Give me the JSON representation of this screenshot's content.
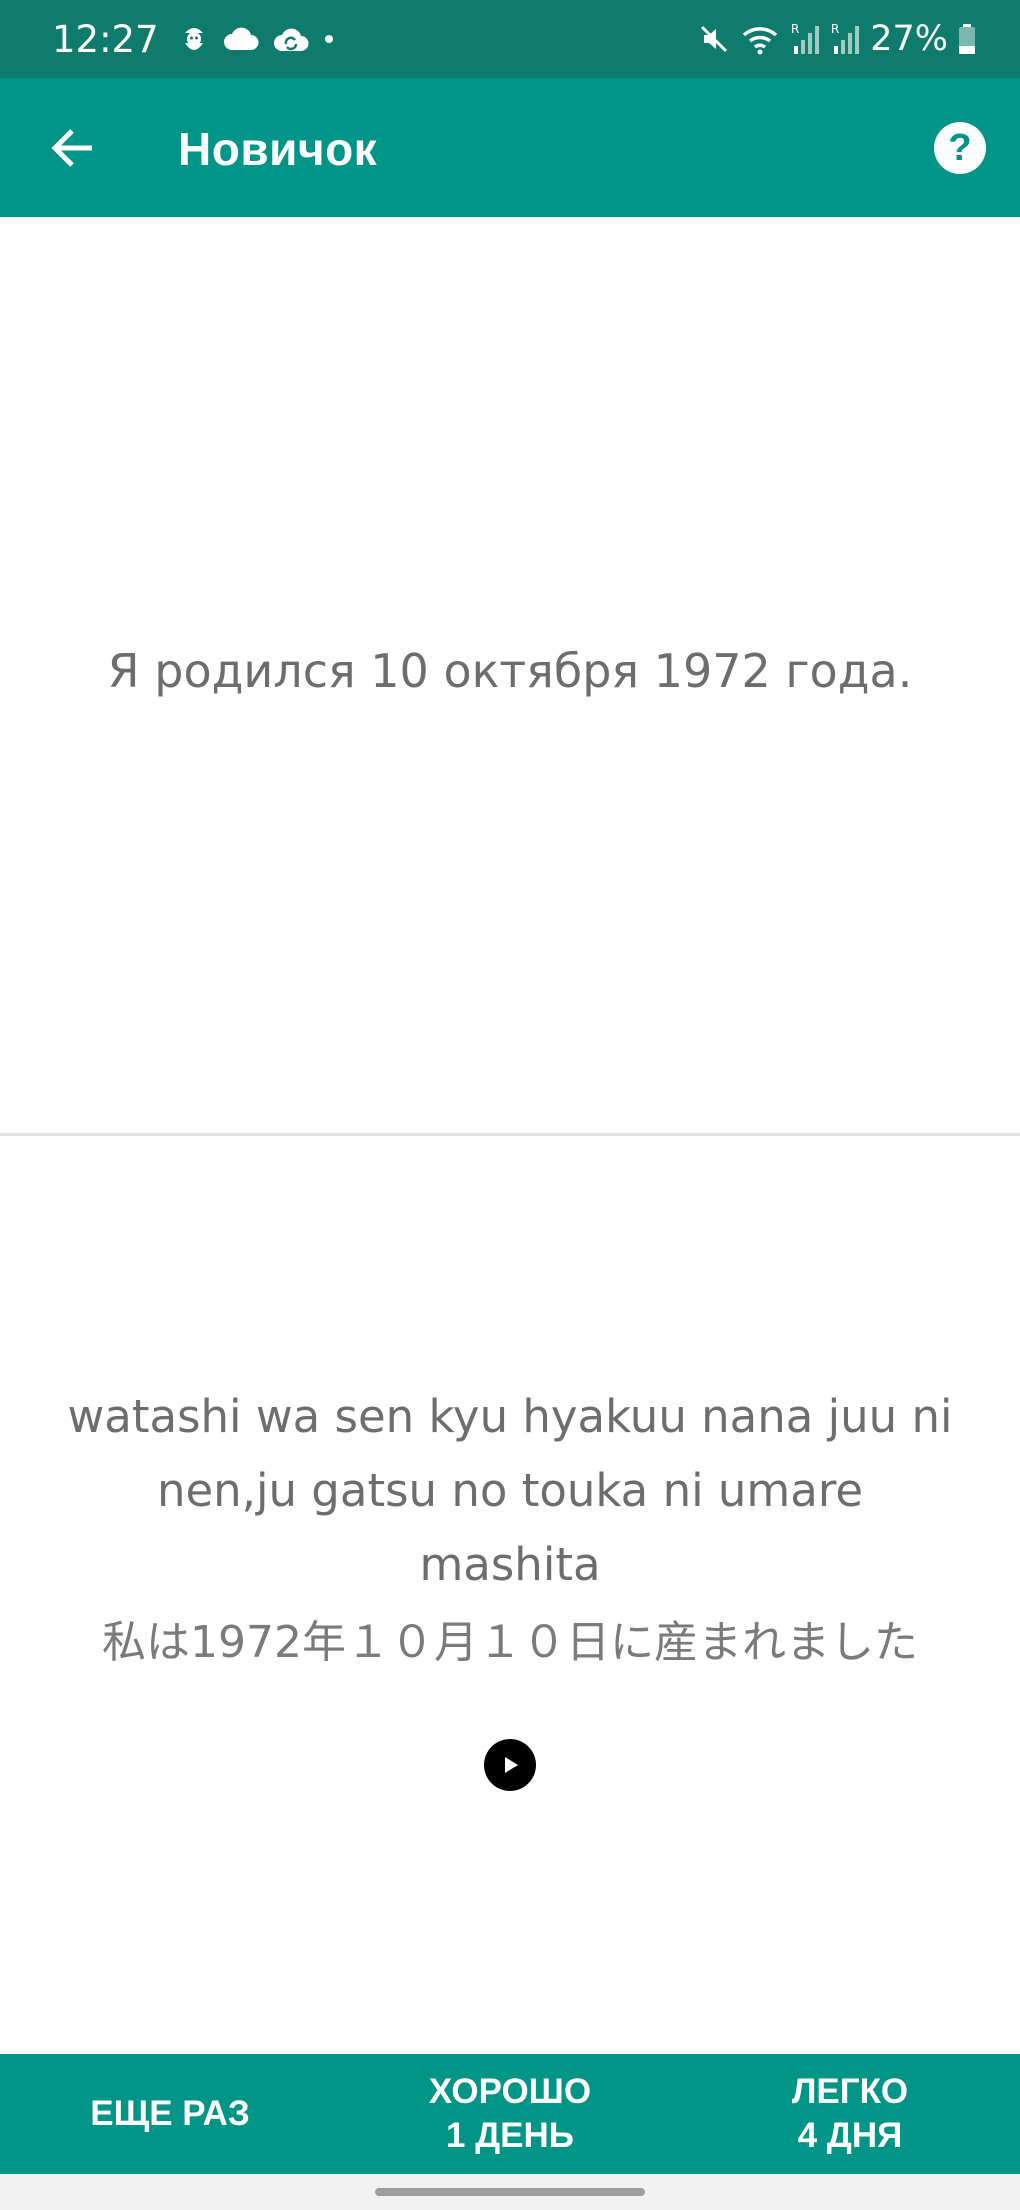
{
  "status_bar": {
    "time": "12:27",
    "battery": "27%",
    "left_icons": [
      "santa-notification-icon",
      "cloud-icon",
      "cloud-sync-icon",
      "dot-icon"
    ],
    "right_icons": [
      "mute-icon",
      "wifi-icon",
      "signal-r-icon",
      "signal-r-icon",
      "battery-icon"
    ]
  },
  "app_bar": {
    "title": "Новичок",
    "back_icon": "arrow-left-icon",
    "help_icon": "question-circle-icon",
    "help_glyph": "?"
  },
  "card": {
    "front_text": "Я родился 10 октября 1972 года.",
    "romaji_line1": "watashi wa sen kyu hyakuu nana juu ni",
    "romaji_line2": "nen,ju gatsu no touka ni umare mashita",
    "japanese": "私は1972年１０月１０日に産まれました",
    "play_icon": "play-icon"
  },
  "answer_buttons": {
    "again": "ЕЩЕ РАЗ",
    "good_label": "ХОРОШО",
    "good_interval": "1 ДЕНЬ",
    "easy_label": "ЛЕГКО",
    "easy_interval": "4 ДНЯ"
  },
  "colors": {
    "status_bar": "#0f7b6d",
    "primary": "#009586",
    "text_secondary": "#6d6d6d",
    "divider": "#e0e0e0"
  }
}
